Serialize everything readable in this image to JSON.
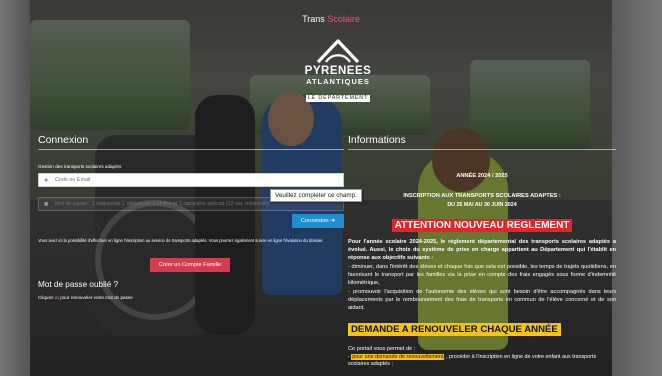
{
  "header": {
    "brand_prefix": "Trans",
    "brand_accent": "Scolaire",
    "logo_line1": "PYRENEES",
    "logo_line2": "ATLANTIQUES",
    "logo_line3": "LE DÉPARTEMENT"
  },
  "login": {
    "title": "Connexion",
    "caption": "Gestion des transports scolaires adaptés",
    "user_placeholder": "Code ou Email",
    "password_placeholder": "Mot de passe : 1 majuscule 1 minuscule 1 chiffre et 1 caractère spécial (12 car. minimum)",
    "tooltip": "Veuillez compléter ce champ.",
    "login_button": "Connexion",
    "info_text": "Vous avez ici la possibilité d'effectuer en ligne l'inscription au service de transports adaptés. Vous pourrez également suivre en ligne l'évolution du dossier.",
    "create_button": "Créer un Compte Famille",
    "forgot_title": "Mot de passe oublié ?",
    "forgot_prefix": "Cliquez",
    "forgot_link": "ici",
    "forgot_suffix": "pour renouveler votre mot de passe"
  },
  "info": {
    "title": "Informations",
    "year": "ANNÉE 2024 / 2025",
    "inscriptions": "INSCRIPTION AUX TRANSPORTS SCOLAIRES ADAPTES :",
    "dates": "DU 25 MAI AU 30 JUIN 2024",
    "alert": "ATTENTION NOUVEAU REGLEMENT",
    "paragraph": "Pour l'année scolaire 2024-2025, le règlement départemental des transports scolaires adaptés a évolué. Aussi, le choix du système de prise en charge appartient au Département qui l'établit en réponse aux objectifs suivants :",
    "bullet1": "- diminuer, dans l'intérêt des élèves et chaque fois que cela est possible, les temps de trajets quotidiens, en favorisant le transport par les familles via la prise en compte des frais engagés sous forme d'indemnité kilométrique,",
    "bullet2": "- promouvoir l'acquisition de l'autonomie des élèves qui sont besoin d'être accompagnés dans leurs déplacements par le remboursement des frais de transports en commun de l'élève concerné et de son aidant.",
    "yellow_title": "DEMANDE A RENOUVELER CHAQUE ANNÉE",
    "portal": "Ce portail vous permet de :",
    "portal_item1_prefix": "- ",
    "portal_item1_highlight": "pour une demande de renouvellement",
    "portal_item1_suffix": ", procéder à l'inscription en ligne de votre enfant aux transports scolaires adaptés ;"
  },
  "colors": {
    "accent_pink": "#ff4f7b",
    "login_blue": "#1f8fd0",
    "create_red": "#d33d4d",
    "alert_red": "#e0252b",
    "highlight_yellow": "#f4c21b"
  },
  "icons": {
    "user_field": "user-icon",
    "password_field": "lock-icon",
    "login_button": "login-arrow-icon"
  }
}
